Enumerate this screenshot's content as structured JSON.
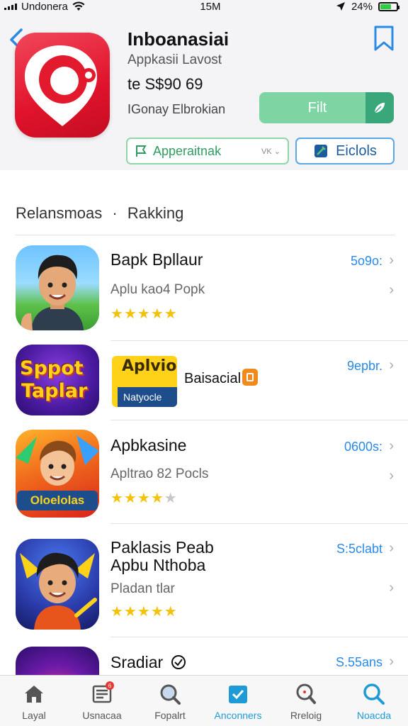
{
  "status": {
    "carrier": "Undonera",
    "time": "15M",
    "battery": "24%",
    "battery_level": 0.7
  },
  "app": {
    "title": "Inboanasiai",
    "subtitle": "Appkasii Lavost",
    "price": "te S$90 69",
    "developer": "IGonay Elbrokian",
    "get_label": "Filt",
    "pill_left": "Apperaitnak",
    "pill_left_sub": "VK",
    "pill_right": "Eiclols"
  },
  "section": {
    "title": "Relansmoas",
    "separator": "·",
    "subtitle": "Rakking"
  },
  "items": [
    {
      "name": "Bapk Bpllaur",
      "desc": "Aplu kao4 Popk",
      "price": "5o9o:",
      "rating": 4.5
    },
    {
      "name": "Baisacial",
      "banner_title": "Aplvio",
      "banner_sub": "Natyocle",
      "icon_text_top": "Sppot",
      "icon_text_bottom": "Taplar",
      "price": "9epbr."
    },
    {
      "name": "Apbkasine",
      "desc": "Apltrao 82 Pocls",
      "price": "0600s:",
      "icon_text": "Oloelolas",
      "rating": 3.5
    },
    {
      "name": "Paklasis Peab",
      "name2": "Apbu Nthoba",
      "desc": "Pladan tlar",
      "price": "S:5clabt",
      "rating": 4.5
    },
    {
      "name": "Sradiar",
      "price": "S.55ans"
    }
  ],
  "tabs": [
    {
      "label": "Layal",
      "icon": "home-icon"
    },
    {
      "label": "Usnacaa",
      "icon": "news-icon",
      "badge": "6"
    },
    {
      "label": "Fopalrt",
      "icon": "search-globe-icon"
    },
    {
      "label": "Anconners",
      "icon": "calendar-check-icon"
    },
    {
      "label": "Rreloig",
      "icon": "location-search-icon"
    },
    {
      "label": "Noacda",
      "icon": "search-icon"
    }
  ]
}
